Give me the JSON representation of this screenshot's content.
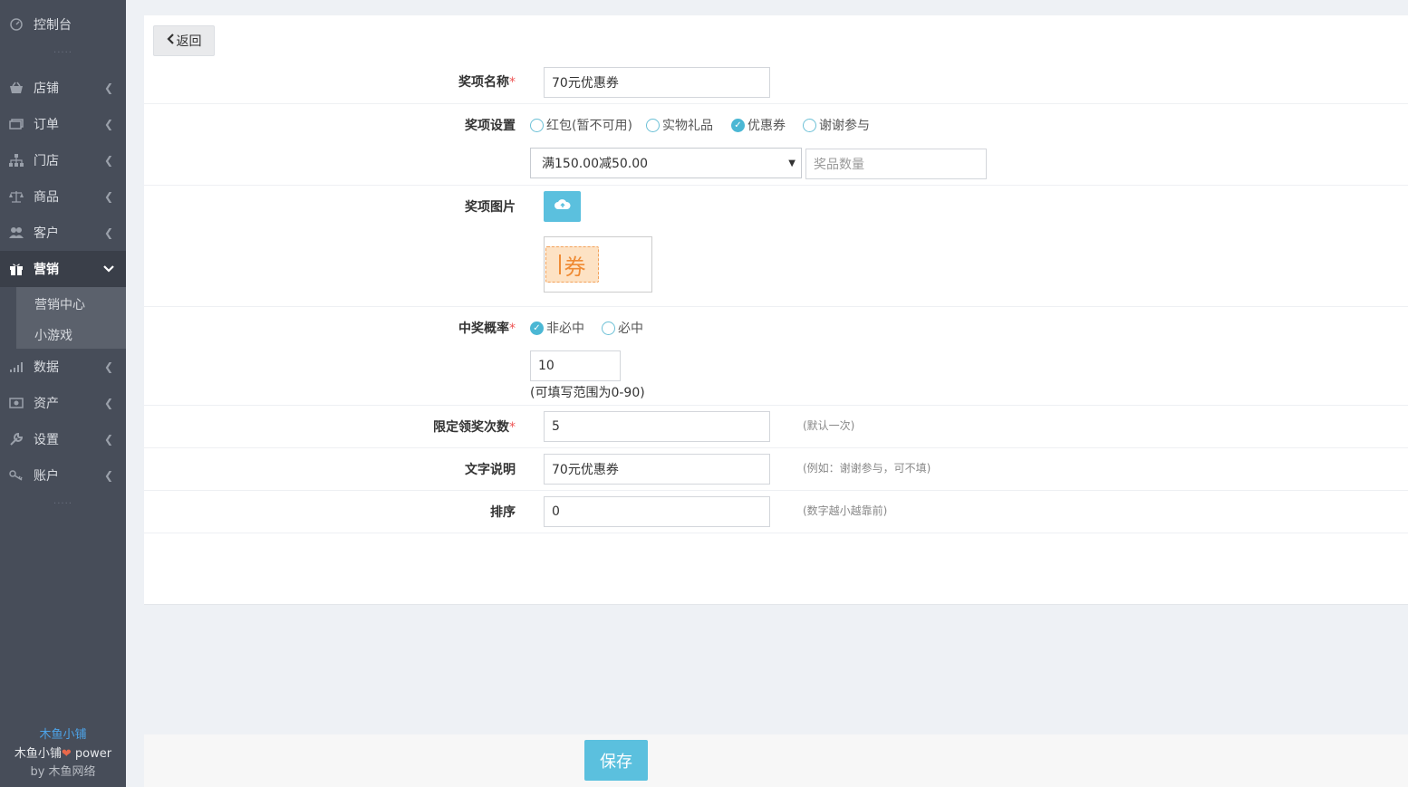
{
  "sidebar": {
    "console": "控制台",
    "dots": "·····",
    "items": [
      {
        "label": "店铺",
        "icon": "basket-icon"
      },
      {
        "label": "订单",
        "icon": "card-icon"
      },
      {
        "label": "门店",
        "icon": "sitemap-icon"
      },
      {
        "label": "商品",
        "icon": "scale-icon"
      },
      {
        "label": "客户",
        "icon": "users-icon"
      },
      {
        "label": "营销",
        "icon": "gift-icon"
      },
      {
        "label": "数据",
        "icon": "signal-icon"
      },
      {
        "label": "资产",
        "icon": "money-icon"
      },
      {
        "label": "设置",
        "icon": "wrench-icon"
      },
      {
        "label": "账户",
        "icon": "key-icon"
      }
    ],
    "submenu": [
      "营销中心",
      "小游戏"
    ],
    "brand": {
      "name": "木鱼小铺",
      "line_prefix": "木鱼小铺",
      "line_suffix": " power",
      "by_prefix": "by ",
      "by_name": "木鱼网络"
    }
  },
  "form": {
    "back_label": "返回",
    "prize_name_label": "奖项名称",
    "prize_name_value": "70元优惠券",
    "prize_setting_label": "奖项设置",
    "prize_types": [
      "红包(暂不可用)",
      "实物礼品",
      "优惠券",
      "谢谢参与"
    ],
    "selected_prize_type": "优惠券",
    "coupon_select_value": "满150.00减50.00",
    "quantity_placeholder": "奖品数量",
    "prize_image_label": "奖项图片",
    "coupon_image_text": "券",
    "probability_label": "中奖概率",
    "probability_options": [
      "非必中",
      "必中"
    ],
    "selected_probability": "非必中",
    "probability_value": "10",
    "probability_note": "(可填写范围为0-90)",
    "limit_label": "限定领奖次数",
    "limit_value": "5",
    "limit_hint": "(默认一次)",
    "text_label": "文字说明",
    "text_value": "70元优惠券",
    "text_hint": "(例如：谢谢参与，可不填)",
    "sort_label": "排序",
    "sort_value": "0",
    "sort_hint": "(数字越小越靠前)",
    "required_mark": "*"
  },
  "footer": {
    "save_label": "保存"
  },
  "colors": {
    "sidebar_bg": "#474d59",
    "accent": "#5bc0de",
    "brand": "#4da3e8",
    "required": "#ee5555"
  }
}
